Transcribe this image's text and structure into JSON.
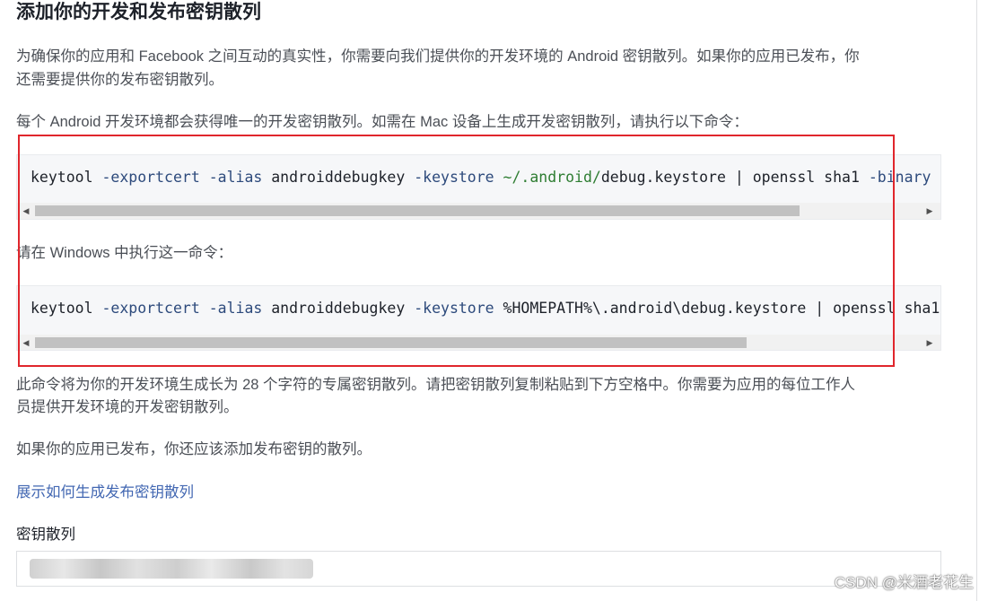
{
  "heading": "添加你的开发和发布密钥散列",
  "intro_line1": "为确保你的应用和 Facebook 之间互动的真实性，你需要向我们提供你的开发环境的 Android 密钥散列。如果你的应用已发布，你",
  "intro_line2": "还需要提供你的发布密钥散列。",
  "mac_instruction": "每个 Android 开发环境都会获得唯一的开发密钥散列。如需在 Mac 设备上生成开发密钥散列，请执行以下命令：",
  "mac_command": {
    "p1": "keytool ",
    "p2": "-exportcert ",
    "p3": "-alias",
    "p4": " androiddebugkey ",
    "p5": "-keystore ",
    "p6": "~/.android/",
    "p7": "debug.keystore | openssl sha1 ",
    "p8": "-binary",
    "p9": " |"
  },
  "windows_instruction": "请在 Windows 中执行这一命令：",
  "win_command": {
    "p1": "keytool ",
    "p2": "-exportcert ",
    "p3": "-alias",
    "p4": " androiddebugkey ",
    "p5": "-keystore ",
    "p6": "%HOMEPATH%\\.android\\debug.keystore | openssl sha1"
  },
  "result_line1": "此命令将为你的开发环境生成长为 28 个字符的专属密钥散列。请把密钥散列复制粘贴到下方空格中。你需要为应用的每位工作人",
  "result_line2": "员提供开发环境的开发密钥散列。",
  "release_note": "如果你的应用已发布，你还应该添加发布密钥的散列。",
  "show_release_link": "展示如何生成发布密钥散列",
  "key_hash_label": "密钥散列",
  "watermark": "CSDN @米酒老花生",
  "colors": {
    "highlight_box": "#e0262c",
    "link": "#4267b2"
  }
}
